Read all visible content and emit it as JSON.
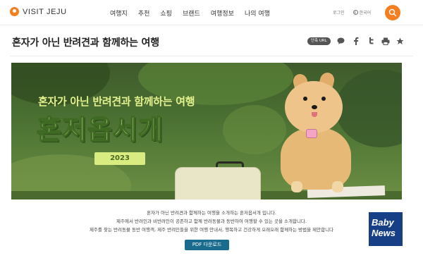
{
  "header": {
    "logo_text": "VISIT JEJU",
    "nav": [
      "여행지",
      "추천",
      "쇼핑",
      "브랜드",
      "여행정보",
      "나의 여행"
    ],
    "login": "로그인",
    "language": "한국어",
    "accent_color": "#f47f20"
  },
  "page": {
    "title": "혼자가 아닌 반려견과 함께하는 여행",
    "short_url_label": "단축 URL",
    "share_icons": [
      "talk-icon",
      "facebook-icon",
      "twitter-icon",
      "print-icon",
      "bookmark-icon"
    ]
  },
  "hero": {
    "line1": "혼자가 아닌 반려견과 함께하는 여행",
    "line2": "혼저옵서개",
    "year": "2023"
  },
  "intro": {
    "lines": [
      "혼자가 아닌 반려견과 함께하는 여행을 소개하는 혼저옵서개 입니다.",
      "제주에서 반려인과 비반려인이 공존하고 함께 반려동물과 동반하여 여행할 수 있는 곳을 소개합니다.",
      "제주를 찾는 반려동물 동반 여행객, 제주 반려인들을 위한 여행 안내서, 행복하고 건강하게 오래오래 함께하는 방법을 제안합니다"
    ],
    "pdf_button": "PDF 다운로드"
  },
  "watermark": {
    "line1": "Baby",
    "line2": "News"
  }
}
